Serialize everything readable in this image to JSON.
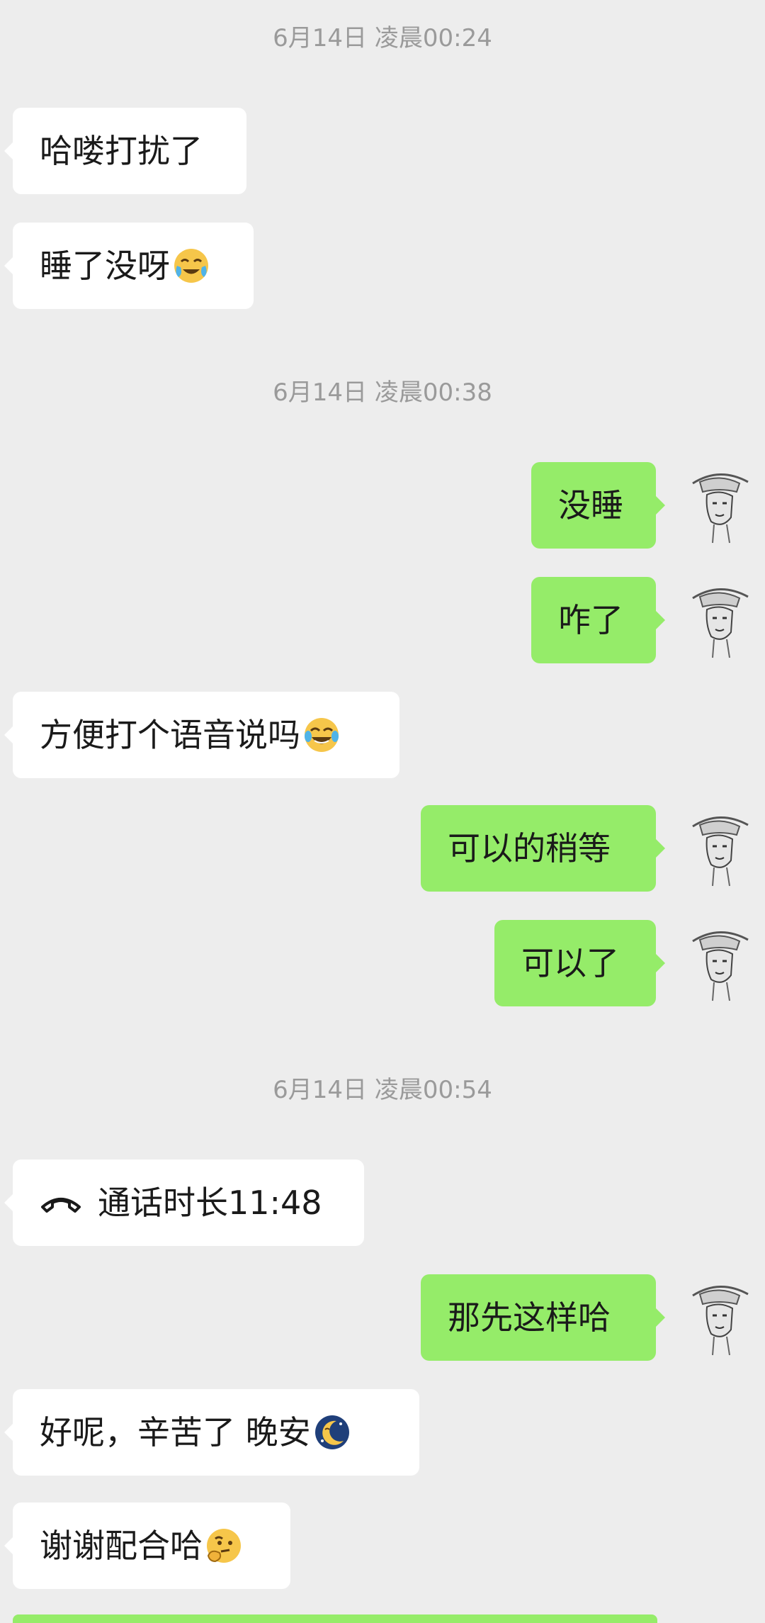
{
  "timestamps": [
    "6月14日 凌晨00:24",
    "6月14日 凌晨00:38",
    "6月14日 凌晨00:54"
  ],
  "messages": [
    {
      "side": "left",
      "text": "哈喽打扰了",
      "emoji": ""
    },
    {
      "side": "left",
      "text": "睡了没呀",
      "emoji": "crying-laughing-emoji"
    },
    {
      "side": "right",
      "text": "没睡",
      "emoji": ""
    },
    {
      "side": "right",
      "text": "咋了",
      "emoji": ""
    },
    {
      "side": "left",
      "text": "方便打个语音说吗",
      "emoji": "tears-of-joy-emoji"
    },
    {
      "side": "right",
      "text": "可以的稍等",
      "emoji": ""
    },
    {
      "side": "right",
      "text": "可以了",
      "emoji": ""
    },
    {
      "side": "left",
      "text": "通话时长11:48",
      "emoji": "",
      "icon": "phone-hangup-icon"
    },
    {
      "side": "right",
      "text": "那先这样哈",
      "emoji": ""
    },
    {
      "side": "left",
      "text": "好呢，辛苦了  晚安",
      "emoji": "moon-emoji"
    },
    {
      "side": "left",
      "text": "谢谢配合哈",
      "emoji": "thinking-face-emoji"
    }
  ],
  "colors": {
    "background": "#ededed",
    "incoming": "#ffffff",
    "outgoing": "#95ec69",
    "timestamp": "#9a9a9a"
  }
}
